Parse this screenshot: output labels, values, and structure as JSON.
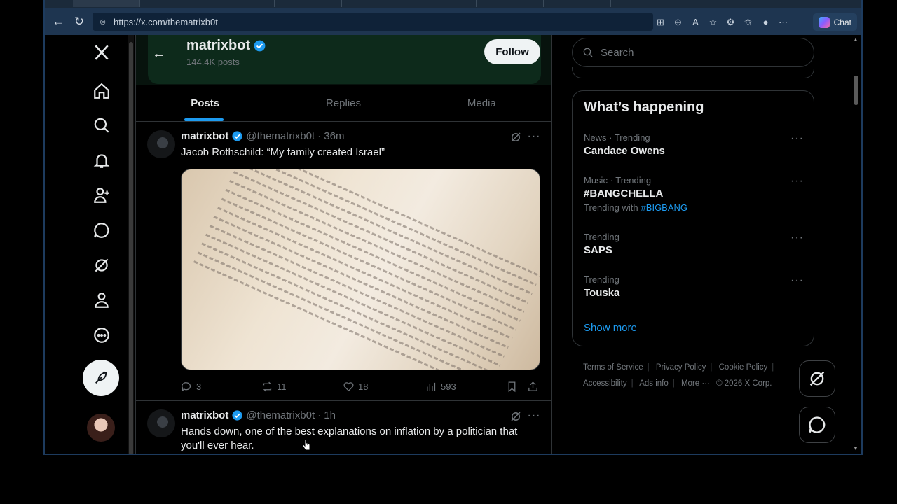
{
  "browser": {
    "url": "https://x.com/thematrixb0t",
    "chat_label": "Chat"
  },
  "profile": {
    "name": "matrixbot",
    "posts_count": "144.4K posts",
    "follow_label": "Follow"
  },
  "tabs": [
    {
      "label": "Posts",
      "active": true
    },
    {
      "label": "Replies",
      "active": false
    },
    {
      "label": "Media",
      "active": false
    }
  ],
  "tweets": [
    {
      "name": "matrixbot",
      "handle": "@thematrixb0t",
      "time": "· 36m",
      "text": "Jacob Rothschild: “My family created Israel”",
      "replies": "3",
      "reposts": "11",
      "likes": "18",
      "views": "593"
    },
    {
      "name": "matrixbot",
      "handle": "@thematrixb0t",
      "time": "· 1h",
      "text": "Hands down, one of the best explanations on inflation by a politician that you'll ever hear."
    }
  ],
  "sidebar": {
    "search_placeholder": "Search",
    "happening_title": "What’s happening",
    "trends": [
      {
        "meta": "News · Trending",
        "name": "Candace Owens"
      },
      {
        "meta": "Music · Trending",
        "name": "#BANGCHELLA",
        "with_label": "Trending with",
        "with_tag": "#BIGBANG"
      },
      {
        "meta": "Trending",
        "name": "SAPS"
      },
      {
        "meta": "Trending",
        "name": "Touska"
      }
    ],
    "show_more": "Show more",
    "footer": [
      "Terms of Service",
      "Privacy Policy",
      "Cookie Policy",
      "Accessibility",
      "Ads info",
      "More ···",
      "© 2026 X Corp."
    ]
  },
  "colors": {
    "accent": "#1d9bf0",
    "verified": "#1d9bf0",
    "background": "#000000"
  }
}
